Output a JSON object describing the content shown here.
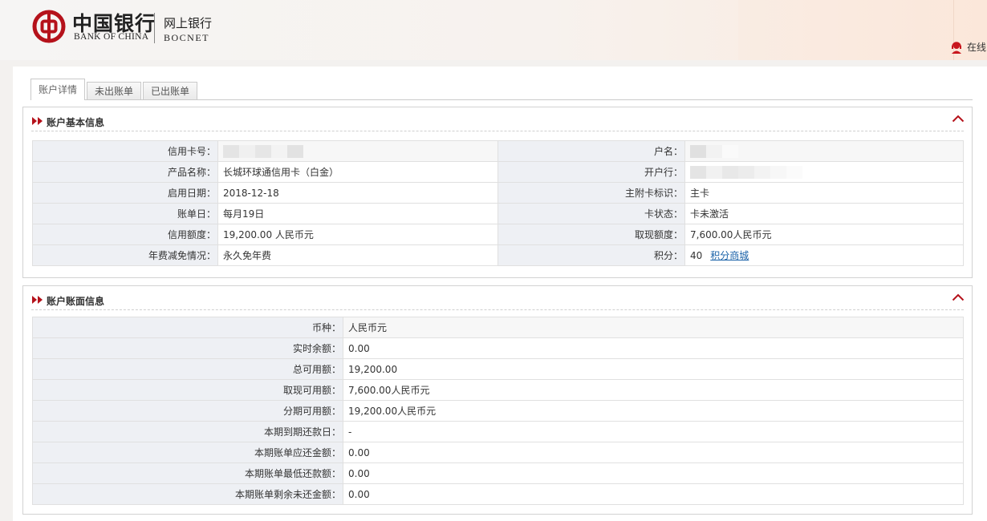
{
  "header": {
    "bank_name_cn": "中国银行",
    "bank_name_en": "BANK OF CHINA",
    "product_cn": "网上银行",
    "product_en": "BOCNET",
    "online_service": "在线"
  },
  "tabs": [
    {
      "label": "账户详情"
    },
    {
      "label": "未出账单"
    },
    {
      "label": "已出账单"
    }
  ],
  "basic_info": {
    "title": "账户基本信息",
    "rows": [
      {
        "l_label": "信用卡号：",
        "l_value": "",
        "r_label": "户名：",
        "r_value": ""
      },
      {
        "l_label": "产品名称：",
        "l_value": "长城环球通信用卡（白金）",
        "r_label": "开户行：",
        "r_value": ""
      },
      {
        "l_label": "启用日期：",
        "l_value": "2018-12-18",
        "r_label": "主附卡标识：",
        "r_value": "主卡"
      },
      {
        "l_label": "账单日：",
        "l_value": "每月19日",
        "r_label": "卡状态：",
        "r_value": "卡未激活"
      },
      {
        "l_label": "信用额度：",
        "l_value": "19,200.00 人民币元",
        "r_label": "取现额度：",
        "r_value": "7,600.00人民币元"
      },
      {
        "l_label": "年费减免情况：",
        "l_value": "永久免年费",
        "r_label": "积分：",
        "r_value": "40",
        "r_link": "积分商城"
      }
    ]
  },
  "balance_info": {
    "title": "账户账面信息",
    "rows": [
      {
        "label": "币种：",
        "value": "人民币元"
      },
      {
        "label": "实时余额：",
        "value": "0.00"
      },
      {
        "label": "总可用额：",
        "value": "19,200.00"
      },
      {
        "label": "取现可用额：",
        "value": "7,600.00人民币元"
      },
      {
        "label": "分期可用额：",
        "value": "19,200.00人民币元"
      },
      {
        "label": "本期到期还款日：",
        "value": "-"
      },
      {
        "label": "本期账单应还金额：",
        "value": "0.00"
      },
      {
        "label": "本期账单最低还款额：",
        "value": "0.00"
      },
      {
        "label": "本期账单剩余未还金额：",
        "value": "0.00"
      }
    ]
  },
  "colors": {
    "brand_red": "#b5121b",
    "alert_red": "#d9261c",
    "link_blue": "#1a62a8",
    "label_bg": "#eef0f4"
  },
  "icons": {
    "logo": "bank-of-china-logo-icon",
    "service": "customer-service-icon",
    "arrows": "double-arrow-right-icon",
    "collapse": "chevron-up-icon"
  }
}
